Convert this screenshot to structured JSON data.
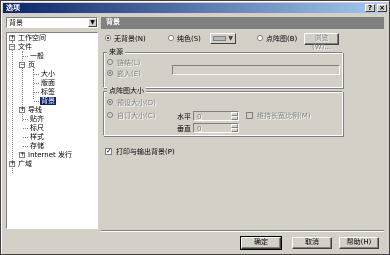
{
  "window": {
    "title": "选项",
    "help_btn": "?",
    "close_btn": "×"
  },
  "left": {
    "combo_value": "背景",
    "tree": [
      {
        "label": "工作空间",
        "expander": "+"
      },
      {
        "label": "文件",
        "expander": "−"
      },
      {
        "label": "一般"
      },
      {
        "label": "页",
        "expander": "−"
      },
      {
        "label": "大小"
      },
      {
        "label": "版面"
      },
      {
        "label": "标签"
      },
      {
        "label": "背景"
      },
      {
        "label": "导线",
        "expander": "+"
      },
      {
        "label": "贴齐"
      },
      {
        "label": "标尺"
      },
      {
        "label": "样式"
      },
      {
        "label": "存储"
      },
      {
        "label": "Internet 发行",
        "expander": "+"
      },
      {
        "label": "广域",
        "expander": "+"
      }
    ]
  },
  "panel": {
    "header": "背景",
    "bg_none": "无背景(N)",
    "bg_solid": "纯色(S)",
    "bg_bitmap": "点阵图(B)",
    "browse": "浏览(W)...",
    "source_title": "来源",
    "link": "链结(L)",
    "embed": "嵌入(E)",
    "size_title": "点阵图大小",
    "default_size": "预设大小(D)",
    "custom_size": "自订大小(C)",
    "horizontal": "水平",
    "vertical": "垂直",
    "h_value": "0",
    "v_value": "0",
    "keep_aspect": "维持长宽比例(M)",
    "print_export": "打印与输出背景(P)"
  },
  "buttons": {
    "ok": "确定",
    "cancel": "取消",
    "help": "帮助(H)"
  }
}
